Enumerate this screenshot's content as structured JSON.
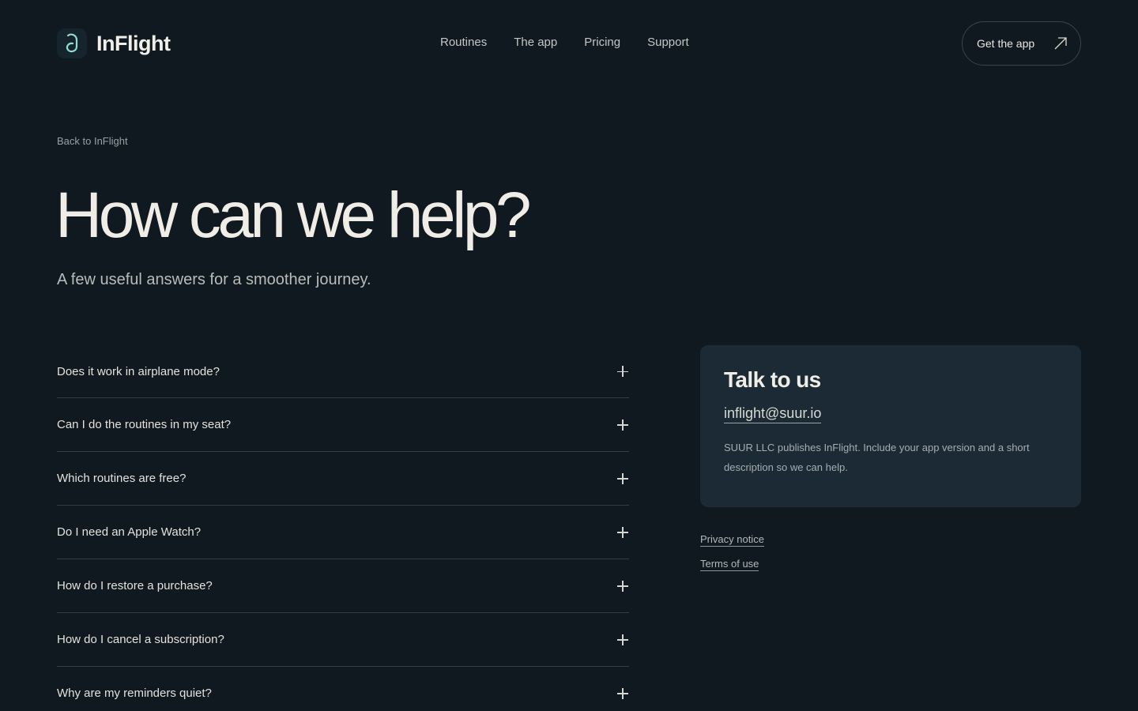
{
  "header": {
    "logo_text": "InFlight",
    "nav": [
      {
        "label": "Routines"
      },
      {
        "label": "The app"
      },
      {
        "label": "Pricing"
      },
      {
        "label": "Support"
      }
    ],
    "cta_label": "Get the app"
  },
  "hero": {
    "back_link": "Back to InFlight",
    "title": "How can we help?",
    "subtitle": "A few useful answers for a smoother journey."
  },
  "faq": [
    {
      "question": "Does it work in airplane mode?"
    },
    {
      "question": "Can I do the routines in my seat?"
    },
    {
      "question": "Which routines are free?"
    },
    {
      "question": "Do I need an Apple Watch?"
    },
    {
      "question": "How do I restore a purchase?"
    },
    {
      "question": "How do I cancel a subscription?"
    },
    {
      "question": "Why are my reminders quiet?"
    }
  ],
  "contact": {
    "title": "Talk to us",
    "email": "inflight@suur.io",
    "description": "SUUR LLC publishes InFlight. Include your app version and a short description so we can help."
  },
  "legal": {
    "privacy": "Privacy notice",
    "terms": "Terms of use"
  },
  "icons": {
    "logo": "logo-icon",
    "cta": "arrow-up-right-icon",
    "faq_toggle": "plus-icon"
  },
  "colors": {
    "background": "#101820",
    "card": "#1b2a35",
    "accent": "#7fd6c4"
  }
}
